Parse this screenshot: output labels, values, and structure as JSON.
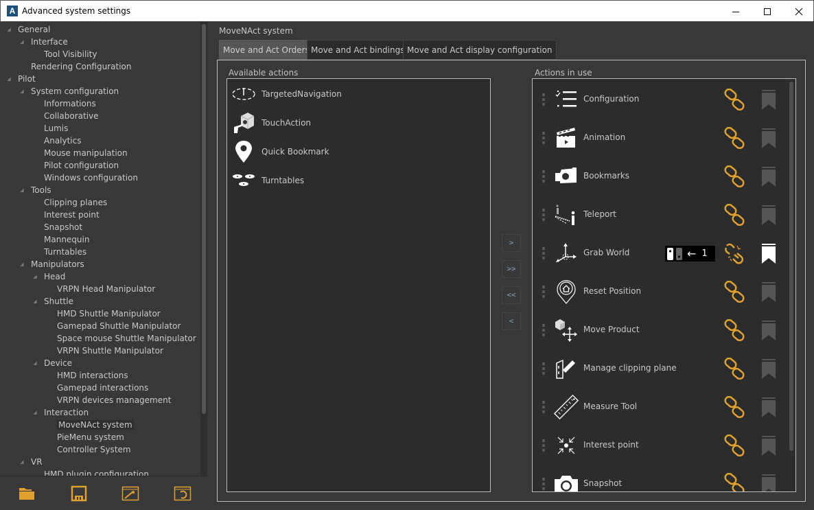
{
  "window": {
    "title": "Advanced system settings",
    "app_icon_letter": "A",
    "controls": {
      "minimize": "—",
      "maximize": "☐",
      "close": "✕"
    }
  },
  "tree": {
    "items": [
      {
        "label": "General",
        "level": 0,
        "expanded": true
      },
      {
        "label": "Interface",
        "level": 1,
        "expanded": true
      },
      {
        "label": "Tool Visibility",
        "level": 2
      },
      {
        "label": "Rendering Configuration",
        "level": 1
      },
      {
        "label": "Pilot",
        "level": 0,
        "expanded": true
      },
      {
        "label": "System configuration",
        "level": 1,
        "expanded": true
      },
      {
        "label": "Informations",
        "level": 2
      },
      {
        "label": "Collaborative",
        "level": 2
      },
      {
        "label": "Lumis",
        "level": 2
      },
      {
        "label": "Analytics",
        "level": 2
      },
      {
        "label": "Mouse manipulation",
        "level": 2
      },
      {
        "label": "Pilot configuration",
        "level": 2
      },
      {
        "label": "Windows configuration",
        "level": 2
      },
      {
        "label": "Tools",
        "level": 1,
        "expanded": true
      },
      {
        "label": "Clipping planes",
        "level": 2
      },
      {
        "label": "Interest point",
        "level": 2
      },
      {
        "label": "Snapshot",
        "level": 2
      },
      {
        "label": "Mannequin",
        "level": 2
      },
      {
        "label": "Turntables",
        "level": 2
      },
      {
        "label": "Manipulators",
        "level": 1,
        "expanded": true
      },
      {
        "label": "Head",
        "level": 2,
        "expanded": true
      },
      {
        "label": "VRPN Head Manipulator",
        "level": 3
      },
      {
        "label": "Shuttle",
        "level": 2,
        "expanded": true
      },
      {
        "label": "HMD Shuttle Manipulator",
        "level": 3
      },
      {
        "label": "Gamepad Shuttle Manipulator",
        "level": 3
      },
      {
        "label": "Space mouse Shuttle Manipulator",
        "level": 3
      },
      {
        "label": "VRPN Shuttle Manipulator",
        "level": 3
      },
      {
        "label": "Device",
        "level": 2,
        "expanded": true
      },
      {
        "label": "HMD interactions",
        "level": 3
      },
      {
        "label": "Gamepad interactions",
        "level": 3
      },
      {
        "label": "VRPN devices management",
        "level": 3
      },
      {
        "label": "Interaction",
        "level": 2,
        "expanded": true
      },
      {
        "label": "MoveNAct system",
        "level": 3,
        "selected": true
      },
      {
        "label": "PieMenu system",
        "level": 3
      },
      {
        "label": "Controller System",
        "level": 3
      },
      {
        "label": "VR",
        "level": 1,
        "expanded": true
      },
      {
        "label": "HMD plugin configuration",
        "level": 2
      }
    ]
  },
  "toolbar": {
    "buttons": [
      {
        "name": "open-folder",
        "icon": "folder-icon"
      },
      {
        "name": "save",
        "icon": "floppy-disk-icon"
      },
      {
        "name": "magic-wand",
        "icon": "wand-window-icon"
      },
      {
        "name": "reset",
        "icon": "reset-window-icon"
      }
    ],
    "accent": "#e0a030"
  },
  "main": {
    "section_title": "MoveNAct system",
    "tabs": [
      {
        "label": "Move and Act Orders",
        "active": true
      },
      {
        "label": "Move and Act bindings",
        "active": false
      },
      {
        "label": "Move and Act display configuration",
        "active": false
      }
    ],
    "available": {
      "label": "Available actions",
      "items": [
        {
          "label": "TargetedNavigation",
          "icon": "targeted-navigation-icon"
        },
        {
          "label": "TouchAction",
          "icon": "touch-action-icon"
        },
        {
          "label": "Quick Bookmark",
          "icon": "map-pin-icon"
        },
        {
          "label": "Turntables",
          "icon": "turntables-icon"
        }
      ]
    },
    "move_buttons": [
      ">",
      ">>",
      "<<",
      "<"
    ],
    "in_use": {
      "label": "Actions in use",
      "items": [
        {
          "label": "Configuration",
          "icon": "checklist-icon",
          "linked": true,
          "bookmarked": false
        },
        {
          "label": "Animation",
          "icon": "clapperboard-icon",
          "linked": true,
          "bookmarked": false
        },
        {
          "label": "Bookmarks",
          "icon": "camera-bookmark-icon",
          "linked": true,
          "bookmarked": false
        },
        {
          "label": "Teleport",
          "icon": "teleport-icon",
          "linked": true,
          "bookmarked": false
        },
        {
          "label": "Grab World",
          "icon": "axes-icon",
          "linked": false,
          "bookmarked": true,
          "binding": {
            "arrow": "←",
            "value": "1"
          }
        },
        {
          "label": "Reset Position",
          "icon": "home-pin-icon",
          "linked": true,
          "bookmarked": false
        },
        {
          "label": "Move Product",
          "icon": "move-cube-icon",
          "linked": true,
          "bookmarked": false
        },
        {
          "label": "Manage clipping plane",
          "icon": "clipping-plane-icon",
          "linked": true,
          "bookmarked": false
        },
        {
          "label": "Measure Tool",
          "icon": "ruler-icon",
          "linked": true,
          "bookmarked": false
        },
        {
          "label": "Interest point",
          "icon": "interest-point-icon",
          "linked": true,
          "bookmarked": false
        },
        {
          "label": "Snapshot",
          "icon": "camera-icon",
          "linked": true,
          "bookmarked": false
        }
      ]
    }
  }
}
